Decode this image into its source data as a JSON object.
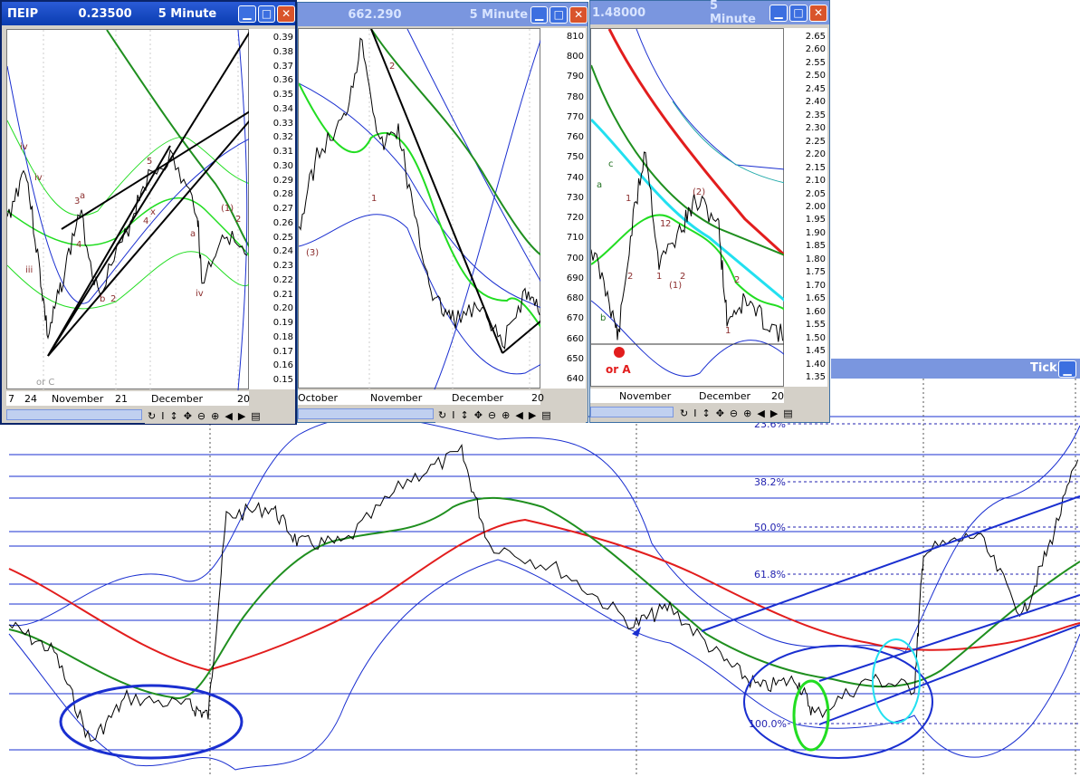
{
  "windows": [
    {
      "symbol": "ΠΕΙΡ",
      "price": "0.23500",
      "interval": "5 Minute",
      "ticks": [
        "0.39",
        "0.38",
        "0.37",
        "0.36",
        "0.35",
        "0.34",
        "0.33",
        "0.32",
        "0.31",
        "0.30",
        "0.29",
        "0.28",
        "0.27",
        "0.26",
        "0.25",
        "0.24",
        "0.23",
        "0.22",
        "0.21",
        "0.20",
        "0.19",
        "0.18",
        "0.17",
        "0.16",
        "0.15"
      ],
      "dates": [
        "7",
        "24",
        "November",
        "21",
        "December",
        "20"
      ]
    },
    {
      "symbol": "",
      "price": "662.290",
      "interval": "5 Minute",
      "ticks": [
        "810",
        "800",
        "790",
        "780",
        "770",
        "760",
        "750",
        "740",
        "730",
        "720",
        "710",
        "700",
        "690",
        "680",
        "670",
        "660",
        "650",
        "640"
      ],
      "dates": [
        "October",
        "November",
        "December",
        "20"
      ]
    },
    {
      "symbol": "",
      "price": "1.48000",
      "interval": "5 Minute",
      "ticks": [
        "2.65",
        "2.60",
        "2.55",
        "2.50",
        "2.45",
        "2.40",
        "2.35",
        "2.30",
        "2.25",
        "2.20",
        "2.15",
        "2.10",
        "2.05",
        "2.00",
        "1.95",
        "1.90",
        "1.85",
        "1.80",
        "1.75",
        "1.70",
        "1.65",
        "1.60",
        "1.55",
        "1.50",
        "1.45",
        "1.40",
        "1.35"
      ],
      "dates": [
        "November",
        "December",
        "20"
      ]
    }
  ],
  "labels_w1": [
    "iv",
    "iv",
    "iii",
    "a",
    "3",
    "4",
    "b",
    "2",
    "5",
    "x",
    "4",
    "a",
    "(1)",
    "2",
    "iv",
    "or C"
  ],
  "labels_w2": [
    "(3)",
    "1",
    "2"
  ],
  "labels_w3": [
    "c",
    "a",
    "b",
    "2",
    "1",
    "1",
    "2",
    "(2)",
    "(1)",
    "2",
    "1",
    "1",
    "2",
    "or A"
  ],
  "bottom": {
    "title": "Tick"
  },
  "chart_data": {
    "type": "line",
    "fib_levels": [
      {
        "label": "23.6%"
      },
      {
        "label": "38.2%"
      },
      {
        "label": "50.0%"
      },
      {
        "label": "61.8%"
      },
      {
        "label": "100.0%"
      }
    ]
  },
  "colors": {
    "titlebar": "#0a3cb0",
    "close": "#d9542b",
    "price": "#000000",
    "green": "#1f8f1f",
    "lime": "#22dd22",
    "red": "#e21d1d",
    "blue": "#1a2fd0",
    "cyan": "#22e0f0",
    "frame": "#d4d0c8"
  }
}
